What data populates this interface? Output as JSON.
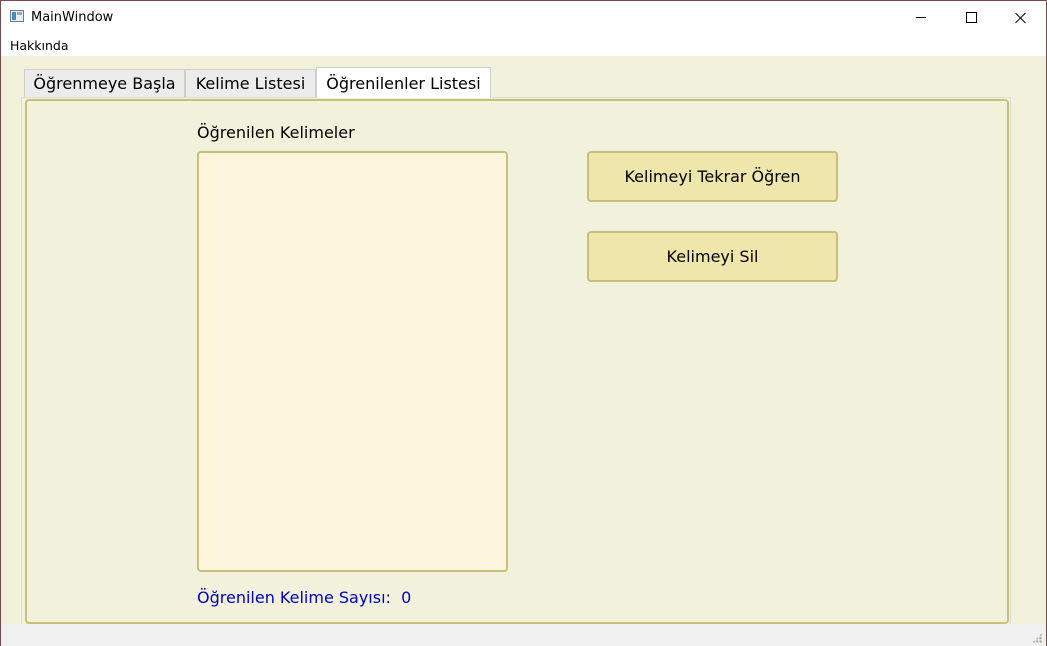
{
  "window": {
    "title": "MainWindow"
  },
  "menu": {
    "items": [
      {
        "label": "Hakkında"
      }
    ]
  },
  "tabs": [
    {
      "label": "Öğrenmeye Başla",
      "active": false
    },
    {
      "label": "Kelime Listesi",
      "active": false
    },
    {
      "label": "Öğrenilenler Listesi",
      "active": true
    }
  ],
  "learned_panel": {
    "list_label": "Öğrenilen Kelimeler",
    "items": [],
    "relearn_button": "Kelimeyi Tekrar Öğren",
    "delete_button": "Kelimeyi Sil",
    "count_label": "Öğrenilen Kelime Sayısı:",
    "count_value": "0"
  },
  "colors": {
    "background": "#f2f2dc",
    "border_accent": "#c8bf7a",
    "button_bg": "#efe6ac",
    "list_bg": "#fdf6dc",
    "count_text": "#0000c8"
  }
}
